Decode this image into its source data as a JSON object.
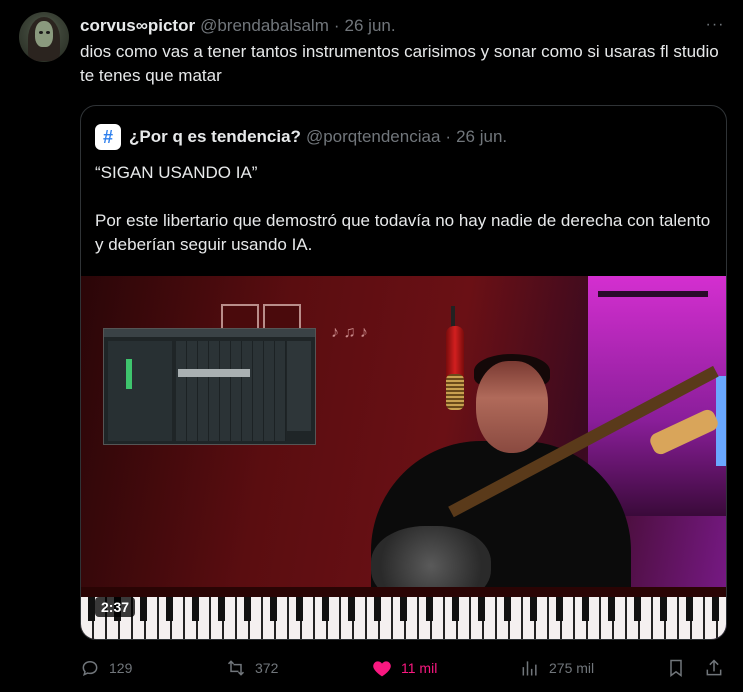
{
  "author": {
    "display_name": "corvus∞pictor",
    "handle": "@brendabalsalm",
    "separator": "·",
    "date": "26 jun."
  },
  "more_label": "···",
  "tweet_text": "dios como vas a tener tantos instrumentos carisimos y sonar como si usaras fl studio te tenes que matar",
  "quote": {
    "avatar_glyph": "#",
    "display_name": "¿Por q es tendencia?",
    "handle": "@porqtendenciaa",
    "separator": "·",
    "date": "26 jun.",
    "text": "“SIGAN USANDO IA”\n\nPor este libertario que demostró que todavía no hay nadie de derecha con talento y deberían seguir usando IA.",
    "video_duration": "2:37"
  },
  "actions": {
    "replies": "129",
    "retweets": "372",
    "likes": "11 mil",
    "views": "275 mil"
  },
  "icons": {
    "reply": "reply-icon",
    "retweet": "retweet-icon",
    "like": "heart-icon",
    "views": "views-icon",
    "bookmark": "bookmark-icon",
    "share": "share-icon"
  },
  "colors": {
    "background": "#000000",
    "text": "#e7e9ea",
    "muted": "#71767b",
    "like": "#f91880",
    "border": "#2f3336"
  }
}
